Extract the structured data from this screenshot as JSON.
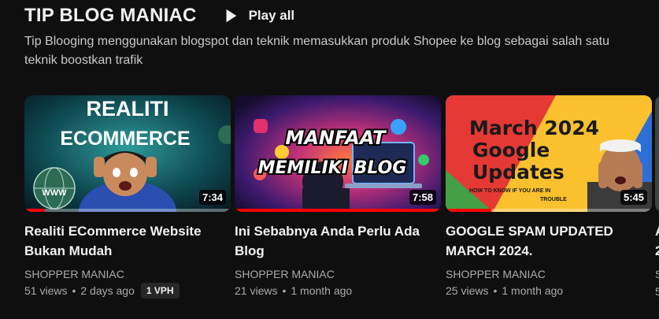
{
  "shelf": {
    "title": "TIP BLOG MANIAC",
    "play_all_label": "Play all",
    "description": "Tip Blooging menggunakan blogspot dan teknik memasukkan produk Shopee ke blog sebagai salah satu teknik boostkan trafik"
  },
  "videos": [
    {
      "title": "Realiti ECommerce Website Bukan Mudah",
      "channel": "SHOPPER MANIAC",
      "views": "51 views",
      "age": "2 days ago",
      "badge": "1 VPH",
      "duration": "7:34",
      "watched_fraction": 0.1,
      "thumb_text": [
        "REALITI",
        "ECOMMERCE"
      ],
      "thumb_badge": "WWW"
    },
    {
      "title": "Ini Sebabnya Anda Perlu Ada Blog",
      "channel": "SHOPPER MANIAC",
      "views": "21 views",
      "age": "1 month ago",
      "duration": "7:58",
      "watched_fraction": 1.0,
      "thumb_text": [
        "MANFAAT",
        "MEMILIKI BLOG"
      ]
    },
    {
      "title": "GOOGLE SPAM UPDATED MARCH 2024.",
      "channel": "SHOPPER MANIAC",
      "views": "25 views",
      "age": "1 month ago",
      "duration": "5:45",
      "watched_fraction": 0.22,
      "thumb_text": [
        "March 2024",
        "Google",
        "Updates",
        "HOW TO KNOW IF YOU ARE IN",
        "TROUBLE"
      ]
    }
  ],
  "peek": {
    "title_lines": [
      "A",
      "2"
    ],
    "channel": "S",
    "meta": "5"
  },
  "colors": {
    "progress": "#ff0000",
    "background": "#0f0f0f",
    "secondary_text": "#aaaaaa"
  }
}
